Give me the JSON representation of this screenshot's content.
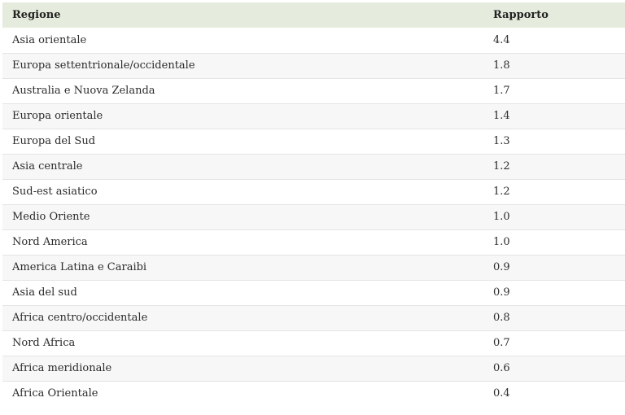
{
  "table": {
    "headers": [
      "Regione",
      "Rapporto"
    ],
    "rows": [
      [
        "Asia orientale",
        "4.4"
      ],
      [
        "Europa settentrionale/occidentale",
        "1.8"
      ],
      [
        "Australia e Nuova Zelanda",
        "1.7"
      ],
      [
        "Europa orientale",
        "1.4"
      ],
      [
        "Europa del Sud",
        "1.3"
      ],
      [
        "Asia centrale",
        "1.2"
      ],
      [
        "Sud-est asiatico",
        "1.2"
      ],
      [
        "Medio Oriente",
        "1.0"
      ],
      [
        "Nord America",
        "1.0"
      ],
      [
        "America Latina e Caraibi",
        "0.9"
      ],
      [
        "Asia del sud",
        "0.9"
      ],
      [
        "Africa centro/occidentale",
        "0.8"
      ],
      [
        "Nord Africa",
        "0.7"
      ],
      [
        "Africa meridionale",
        "0.6"
      ],
      [
        "Africa Orientale",
        "0.4"
      ]
    ]
  },
  "colors": {
    "header_background": "#e5ecdd",
    "zebra_row": "#f7f7f7",
    "row_divider": "#e4e4e4"
  }
}
